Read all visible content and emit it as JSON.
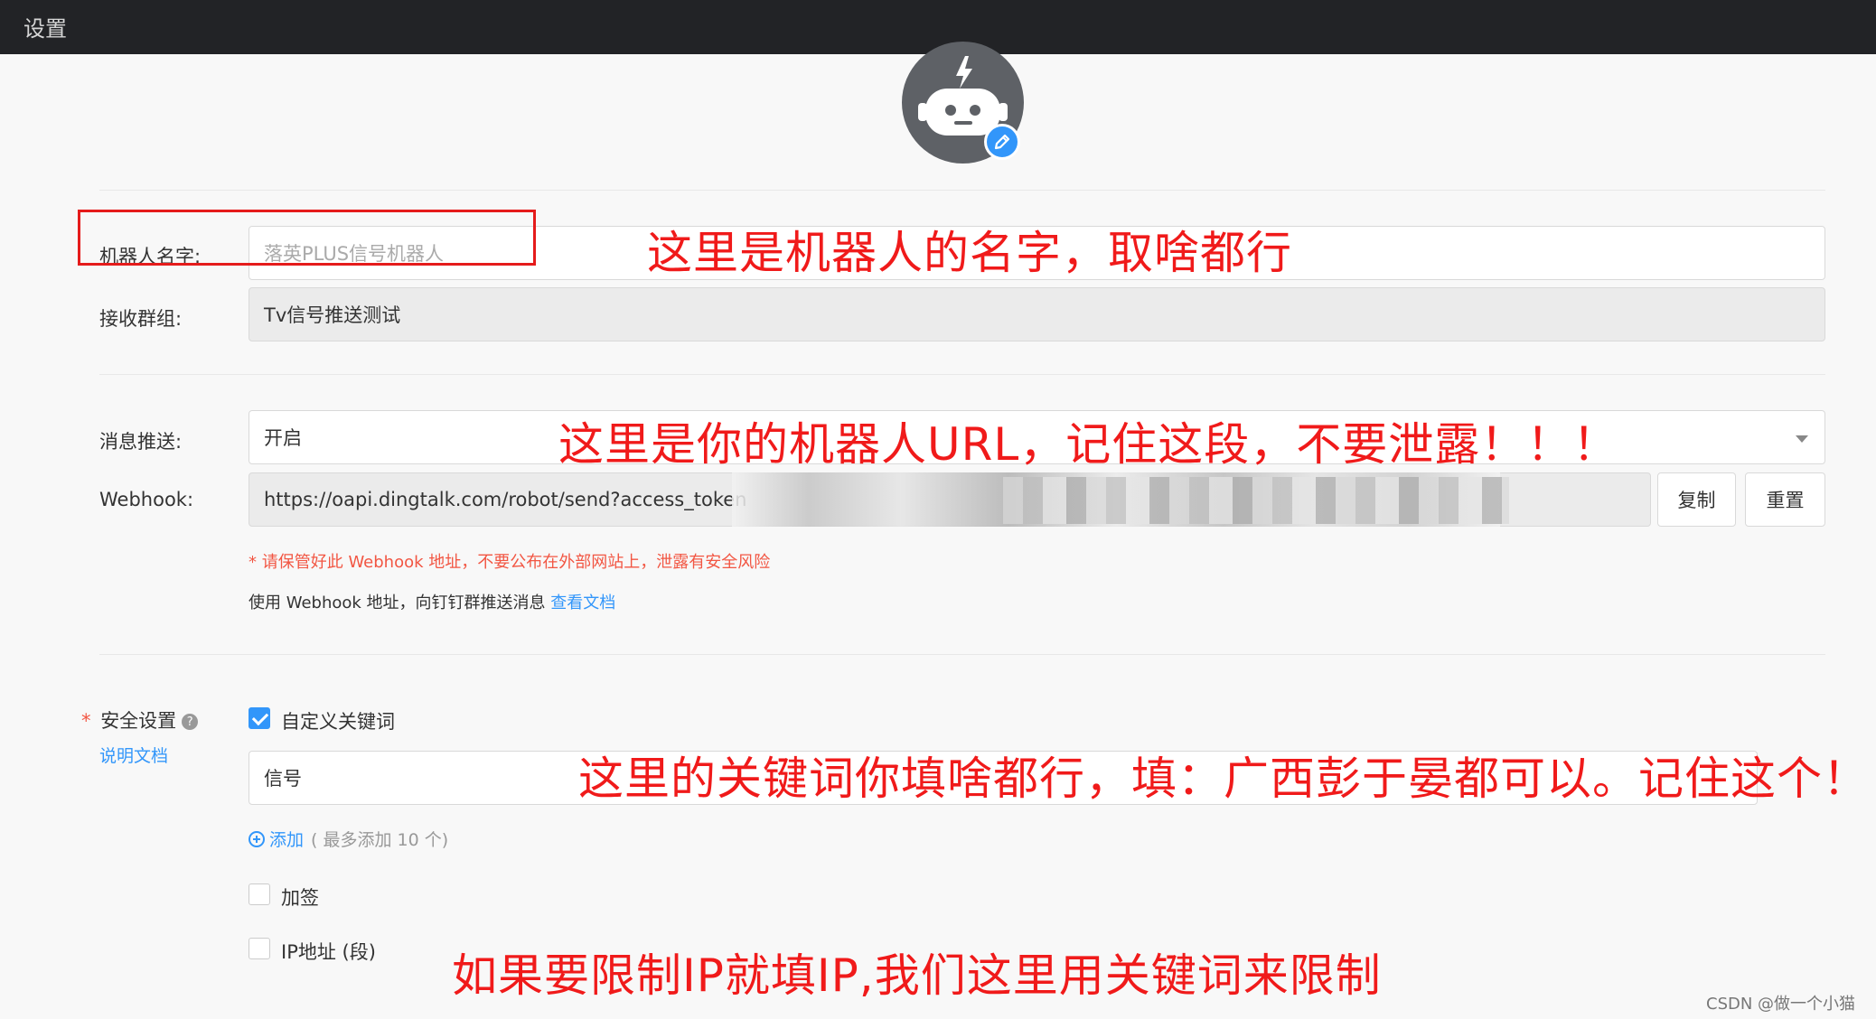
{
  "window": {
    "title": "设置"
  },
  "avatar": {
    "icon": "robot-icon",
    "edit_icon": "pencil-icon",
    "accent": "#3296fa"
  },
  "robot_name": {
    "label": "机器人名字:",
    "placeholder": "落英PLUS信号机器人"
  },
  "receive_group": {
    "label": "接收群组:",
    "value": "Tv信号推送测试"
  },
  "message_push": {
    "label": "消息推送:",
    "value": "开启"
  },
  "webhook": {
    "label": "Webhook:",
    "value": "https://oapi.dingtalk.com/robot/send?access_token",
    "copy_label": "复制",
    "reset_label": "重置",
    "warning": "* 请保管好此 Webhook 地址，不要公布在外部网站上，泄露有安全风险",
    "info_prefix": "使用 Webhook 地址，向钉钉群推送消息",
    "doc_link": "查看文档"
  },
  "security": {
    "required_mark": "*",
    "label": "安全设置",
    "help_icon": "question-icon",
    "doc_link": "说明文档",
    "custom_keyword": {
      "label": "自定义关键词",
      "checked": true
    },
    "keyword_value": "信号",
    "add_label": "添加",
    "add_note": "( 最多添加 10 个)",
    "sign": {
      "label": "加签",
      "checked": false
    },
    "ip": {
      "label": "IP地址 (段)",
      "checked": false
    }
  },
  "annotations": {
    "name": "这里是机器人的名字，取啥都行",
    "url": "这里是你的机器人URL，记住这段，不要泄露！！！",
    "keyword": "这里的关键词你填啥都行，填：广西彭于晏都可以。记住这个！！",
    "ip": "如果要限制IP就填IP,我们这里用关键词来限制",
    "color": "#f01a1a"
  },
  "watermark": "CSDN @做一个小猫"
}
